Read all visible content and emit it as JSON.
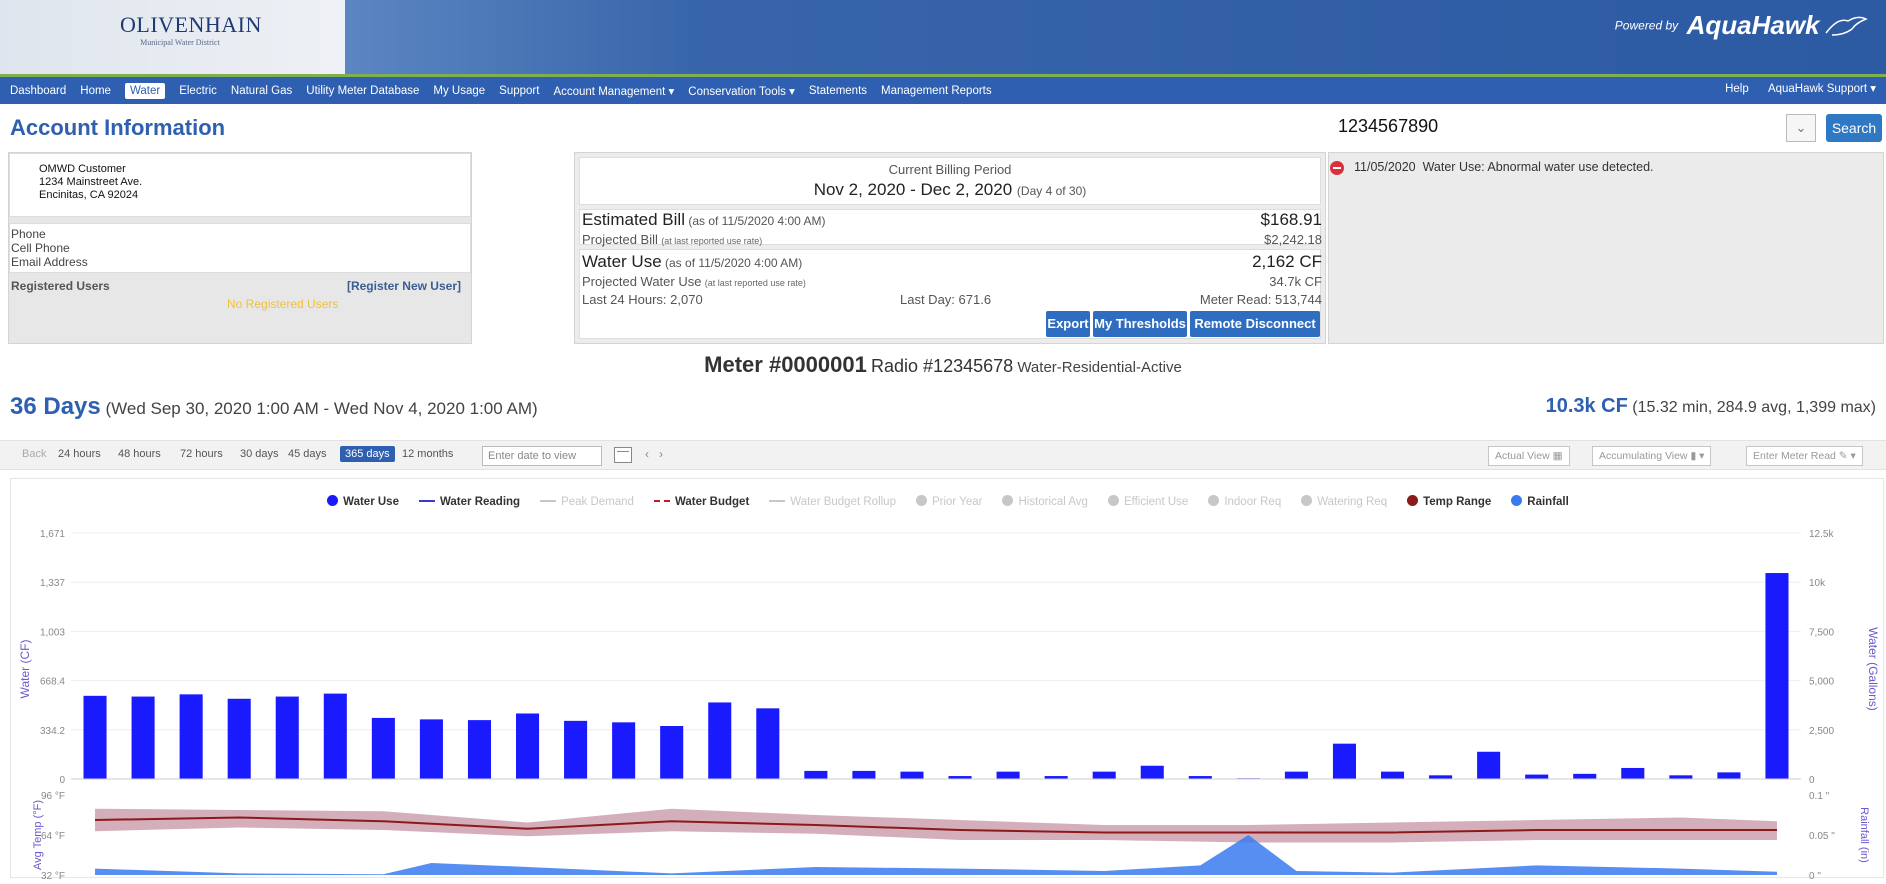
{
  "header": {
    "logo_main": "OLIVENHAIN",
    "logo_sub": "Municipal Water District",
    "powered_by": "Powered by",
    "brand": "AquaHawk"
  },
  "nav": {
    "items": [
      {
        "label": "Dashboard"
      },
      {
        "label": "Home"
      },
      {
        "label": "Water",
        "active": true
      },
      {
        "label": "Electric"
      },
      {
        "label": "Natural Gas"
      },
      {
        "label": "Utility Meter Database"
      },
      {
        "label": "My Usage"
      },
      {
        "label": "Support"
      },
      {
        "label": "Account Management ▾"
      },
      {
        "label": "Conservation Tools ▾"
      },
      {
        "label": "Statements"
      },
      {
        "label": "Management Reports"
      }
    ],
    "help": "Help",
    "support": "AquaHawk Support ▾"
  },
  "account": {
    "title": "Account Information",
    "number": "1234567890",
    "search_label": "Search",
    "customer": {
      "name": "OMWD Customer",
      "street": "1234 Mainstreet Ave.",
      "city": "Encinitas, CA 92024"
    },
    "contact_labels": {
      "phone": "Phone",
      "cell": "Cell Phone",
      "email": "Email Address"
    },
    "registered_users_label": "Registered Users",
    "register_link": "[Register New User]",
    "no_registered": "No Registered Users"
  },
  "billing": {
    "period_label": "Current Billing Period",
    "period_range": "Nov 2, 2020 - Dec 2, 2020",
    "period_day": "(Day 4 of 30)",
    "estimated_label": "Estimated Bill",
    "estimated_asof": "(as of 11/5/2020 4:00 AM)",
    "estimated_value": "$168.91",
    "projected_label": "Projected Bill",
    "projected_note": "(at last reported use rate)",
    "projected_value": "$2,242.18",
    "use_label": "Water Use",
    "use_asof": "(as of 11/5/2020 4:00 AM)",
    "use_value": "2,162 CF",
    "proj_use_label": "Projected Water Use",
    "proj_use_note": "(at last reported use rate)",
    "proj_use_value": "34.7k CF",
    "last24": "Last 24 Hours: 2,070",
    "lastday": "Last Day: 671.6",
    "meter_read": "Meter Read: 513,744",
    "buttons": {
      "export": "Export",
      "thresholds": "My Thresholds",
      "disconnect": "Remote Disconnect"
    }
  },
  "alert": {
    "date": "11/05/2020",
    "text": "Water Use: Abnormal water use detected."
  },
  "meter": {
    "meter_label": "Meter #0000001",
    "radio_label": "Radio #12345678",
    "status": "Water-Residential-Active"
  },
  "range": {
    "title": "36 Days",
    "span": "(Wed Sep 30, 2020 1:00 AM - Wed Nov 4, 2020 1:00 AM)",
    "total": "10.3k CF",
    "stats": "(15.32 min, 284.9 avg, 1,399 max)"
  },
  "toolbar": {
    "back": "Back",
    "periods": [
      "24 hours",
      "48 hours",
      "72 hours",
      "30 days",
      "45 days",
      "365 days",
      "12 months"
    ],
    "selected_period": "365 days",
    "date_placeholder": "Enter date to view",
    "actual_view": "Actual View",
    "accumulating_view": "Accumulating View",
    "enter_meter_read": "Enter Meter Read"
  },
  "chart_data": [
    {
      "type": "bar",
      "legend": [
        {
          "label": "Water Use",
          "color": "#1a1aff",
          "active": true,
          "marker": "dot"
        },
        {
          "label": "Water Reading",
          "color": "#3a3ad0",
          "active": true,
          "marker": "line"
        },
        {
          "label": "Peak Demand",
          "color": "#c7c7c7",
          "active": false,
          "marker": "line"
        },
        {
          "label": "Water Budget",
          "color": "#c7182c",
          "active": true,
          "marker": "dashed"
        },
        {
          "label": "Water Budget Rollup",
          "color": "#c7c7c7",
          "active": false,
          "marker": "line"
        },
        {
          "label": "Prior Year",
          "color": "#c7c7c7",
          "active": false,
          "marker": "dot"
        },
        {
          "label": "Historical Avg",
          "color": "#c7c7c7",
          "active": false,
          "marker": "dot"
        },
        {
          "label": "Efficient Use",
          "color": "#c7c7c7",
          "active": false,
          "marker": "dot"
        },
        {
          "label": "Indoor Req",
          "color": "#c7c7c7",
          "active": false,
          "marker": "dot"
        },
        {
          "label": "Watering Req",
          "color": "#c7c7c7",
          "active": false,
          "marker": "dot"
        },
        {
          "label": "Temp Range",
          "color": "#8b1a1a",
          "active": true,
          "marker": "dot"
        },
        {
          "label": "Rainfall",
          "color": "#3a7af0",
          "active": true,
          "marker": "dot"
        }
      ],
      "ylabel": "Water (CF)",
      "y2label": "Water (Gallons)",
      "yticks": [
        "0",
        "334.2",
        "668.4",
        "1,003",
        "1,337",
        "1,671"
      ],
      "y2ticks": [
        "0",
        "2,500",
        "5,000",
        "7,500",
        "10k",
        "12.5k"
      ],
      "ylim": [
        0,
        1671
      ],
      "values": [
        565,
        560,
        575,
        545,
        560,
        580,
        415,
        405,
        400,
        445,
        395,
        385,
        360,
        520,
        480,
        55,
        55,
        50,
        20,
        50,
        20,
        50,
        90,
        20,
        5,
        50,
        240,
        50,
        25,
        185,
        30,
        35,
        75,
        25,
        45,
        1399
      ],
      "color": "#1a1aff"
    },
    {
      "type": "area",
      "ylabel": "Avg Temp (°F)",
      "y2label": "Rainfall (in)",
      "yticks": [
        "32 °F",
        "64 °F",
        "96 °F"
      ],
      "ylim": [
        32,
        96
      ],
      "y2ticks": [
        "0 \"",
        "0.05 \"",
        "0.1 \""
      ],
      "y2lim": [
        0,
        0.1
      ],
      "temp_x": [
        0,
        3,
        6,
        9,
        12,
        15,
        18,
        21,
        24,
        27,
        30,
        33,
        35
      ],
      "temp_avg": [
        76,
        78,
        75,
        69,
        75,
        72,
        68,
        66,
        66,
        66,
        68,
        68,
        68
      ],
      "temp_high": [
        85,
        84,
        83,
        74,
        85,
        80,
        76,
        72,
        72,
        74,
        76,
        78,
        75
      ],
      "temp_low": [
        67,
        70,
        68,
        63,
        67,
        65,
        60,
        60,
        58,
        58,
        60,
        60,
        60
      ],
      "rain_x": [
        0,
        3,
        6,
        7,
        9,
        12,
        15,
        18,
        21,
        23,
        24,
        25,
        27,
        30,
        33,
        35
      ],
      "rain": [
        0.008,
        0.002,
        0.001,
        0.015,
        0.01,
        0.002,
        0.01,
        0.008,
        0.005,
        0.012,
        0.05,
        0.005,
        0.003,
        0.012,
        0.008,
        0.004
      ],
      "temp_color": "#8b1a1a",
      "rain_color": "#3a7af0"
    }
  ]
}
